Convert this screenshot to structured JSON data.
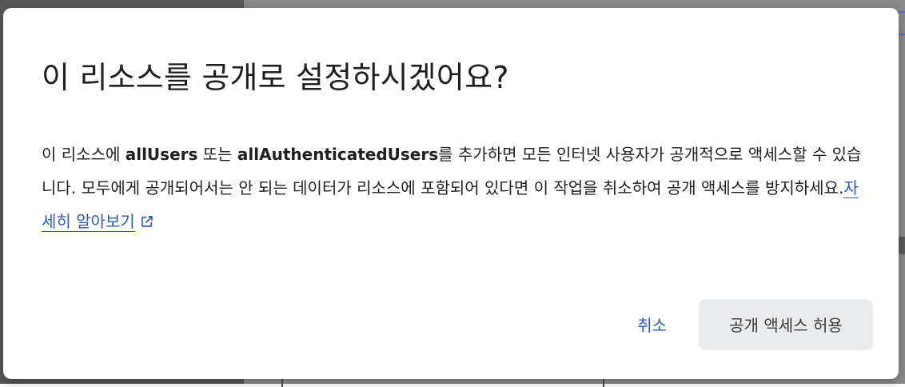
{
  "dialog": {
    "title": "이 리소스를 공개로 설정하시겠어요?",
    "body": {
      "seg1": "이 리소스에 ",
      "term1": "allUsers",
      "seg2": " 또는 ",
      "term2": "allAuthenticatedUsers",
      "seg3": "를 추가하면 모든 인터넷 사용자가 공개적으로 액세스할 수 있습니다. 모두에게 공개되어서는 안 되는 데이터가 리소스에 포함되어 있다면 이 작업을 취소하여 공개 액세스를 방지하세요.",
      "link_label": "자세히 알아보기",
      "link_icon": "external-link-icon"
    },
    "actions": {
      "cancel_label": "취소",
      "confirm_label": "공개 액세스 허용"
    }
  },
  "colors": {
    "link": "#2d5bb7",
    "confirm_bg": "#eaebed",
    "text": "#1f1f1f"
  }
}
